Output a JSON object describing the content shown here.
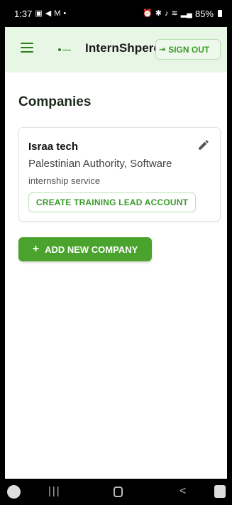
{
  "status_bar": {
    "time": "1:37",
    "left_icons": [
      "gallery-icon",
      "send-icon",
      "gmail-icon",
      "dot-icon"
    ],
    "right_icons": [
      "alarm-icon",
      "bluetooth-icon",
      "mute-icon",
      "wifi-icon",
      "signal-icon"
    ],
    "battery": "85%"
  },
  "app_bar": {
    "title": "InternShpere",
    "sign_out_label": "SIGN OUT",
    "colors": {
      "background": "#e8f6e6",
      "accent": "#3a9a2a"
    }
  },
  "main": {
    "page_title": "Companies",
    "companies": [
      {
        "name": "Israa tech",
        "description": "Palestinian Authority, Software",
        "service": "internship service",
        "action_label": "CREATE TRAINING LEAD ACCOUNT"
      }
    ],
    "add_button_label": "ADD NEW COMPANY",
    "colors": {
      "primary_button": "#4aa32c"
    }
  },
  "nav_bar": {
    "recent_glyph": "|||",
    "back_glyph": "<"
  }
}
